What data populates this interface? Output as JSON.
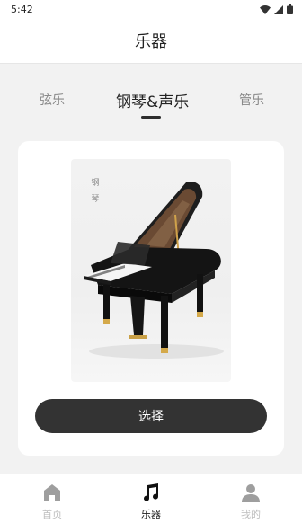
{
  "status_bar": {
    "time": "5:42"
  },
  "header": {
    "title": "乐器"
  },
  "tabs": [
    {
      "label": "弦乐",
      "active": false
    },
    {
      "label": "钢琴&声乐",
      "active": true
    },
    {
      "label": "管乐",
      "active": false
    }
  ],
  "instrument_card": {
    "caption": "钢琴",
    "caption_chars": [
      "钢",
      "琴"
    ],
    "select_label": "选择"
  },
  "bottom_nav": [
    {
      "label": "首页",
      "icon": "home-icon",
      "active": false
    },
    {
      "label": "乐器",
      "icon": "music-note-icon",
      "active": true
    },
    {
      "label": "我的",
      "icon": "person-icon",
      "active": false
    }
  ],
  "colors": {
    "primary": "#333333",
    "inactive": "#bdbdbd",
    "background": "#f2f2f2"
  }
}
